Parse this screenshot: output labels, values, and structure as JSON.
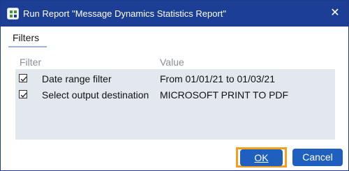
{
  "window": {
    "title": "Run Report \"Message Dynamics Statistics Report\"",
    "close_glyph": "✕"
  },
  "tabs": [
    {
      "label": "Filters",
      "active": true
    }
  ],
  "grid": {
    "columns": [
      "Filter",
      "Value"
    ],
    "rows": [
      {
        "checked": true,
        "filter": "Date range filter",
        "value": "From 01/01/21 to 01/03/21"
      },
      {
        "checked": true,
        "filter": "Select output destination",
        "value": "MICROSOFT PRINT TO PDF"
      }
    ]
  },
  "buttons": {
    "ok": "OK",
    "cancel": "Cancel"
  },
  "colors": {
    "titlebar": "#1c3f95",
    "button": "#1f5fbf",
    "focus_outline": "#f2a11c",
    "grid_background": "#e3e8ef"
  },
  "icons": {
    "app": "report-app-icon",
    "close": "close-icon",
    "checkbox": "checkmark-icon"
  }
}
